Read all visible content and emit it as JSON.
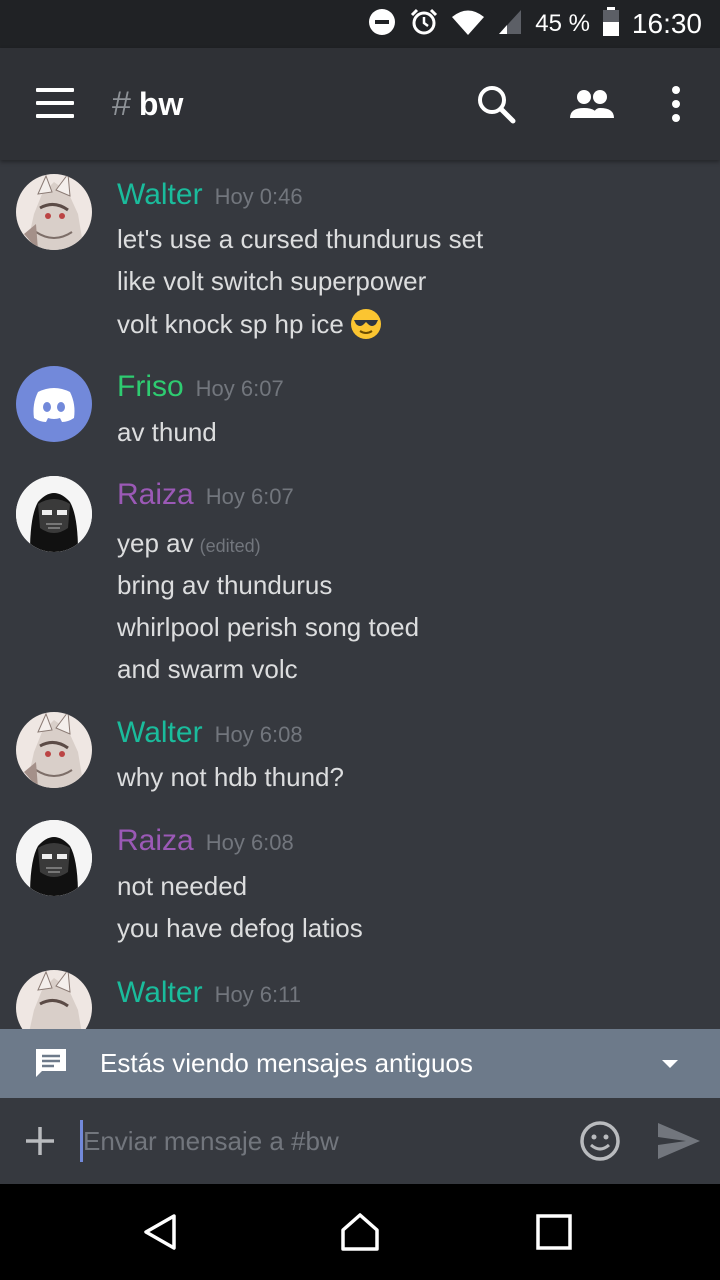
{
  "status_bar": {
    "battery_percent": "45 %",
    "time": "16:30"
  },
  "app_bar": {
    "hash": "#",
    "channel": "bw"
  },
  "messages": [
    {
      "author": "Walter",
      "author_color": "#1abc9c",
      "timestamp": "Hoy 0:46",
      "avatar": "walter-anime-avatar",
      "lines": [
        {
          "text": "let's use a cursed thundurus set"
        },
        {
          "text": "like volt switch superpower"
        },
        {
          "text": "volt knock sp hp ice",
          "emoji": "sunglasses-emoji"
        }
      ]
    },
    {
      "author": "Friso",
      "author_color": "#2ecc71",
      "timestamp": "Hoy 6:07",
      "avatar": "discord-default-avatar",
      "lines": [
        {
          "text": "av thund"
        }
      ]
    },
    {
      "author": "Raiza",
      "author_color": "#9b59b6",
      "timestamp": "Hoy 6:07",
      "avatar": "masked-figure-avatar",
      "lines": [
        {
          "text": "yep av",
          "edited": "(edited)"
        },
        {
          "text": "bring av thundurus"
        },
        {
          "text": "whirlpool perish song toed"
        },
        {
          "text": "and swarm volc"
        }
      ]
    },
    {
      "author": "Walter",
      "author_color": "#1abc9c",
      "timestamp": "Hoy 6:08",
      "avatar": "walter-anime-avatar",
      "lines": [
        {
          "text": "why not hdb thund?"
        }
      ]
    },
    {
      "author": "Raiza",
      "author_color": "#9b59b6",
      "timestamp": "Hoy 6:08",
      "avatar": "masked-figure-avatar",
      "lines": [
        {
          "text": "not needed"
        },
        {
          "text": "you have defog latios"
        }
      ]
    },
    {
      "author": "Walter",
      "author_color": "#1abc9c",
      "timestamp": "Hoy 6:11",
      "avatar": "walter-anime-avatar",
      "lines": []
    }
  ],
  "old_messages_bar": {
    "text": "Estás viendo mensajes antiguos"
  },
  "composer": {
    "placeholder": "Enviar mensaje a #bw"
  },
  "colors": {
    "background": "#36393f",
    "app_bar": "#2f3136",
    "status_bar": "#202225",
    "old_messages_bar": "#6d7a8a",
    "blurple": "#7289da"
  }
}
